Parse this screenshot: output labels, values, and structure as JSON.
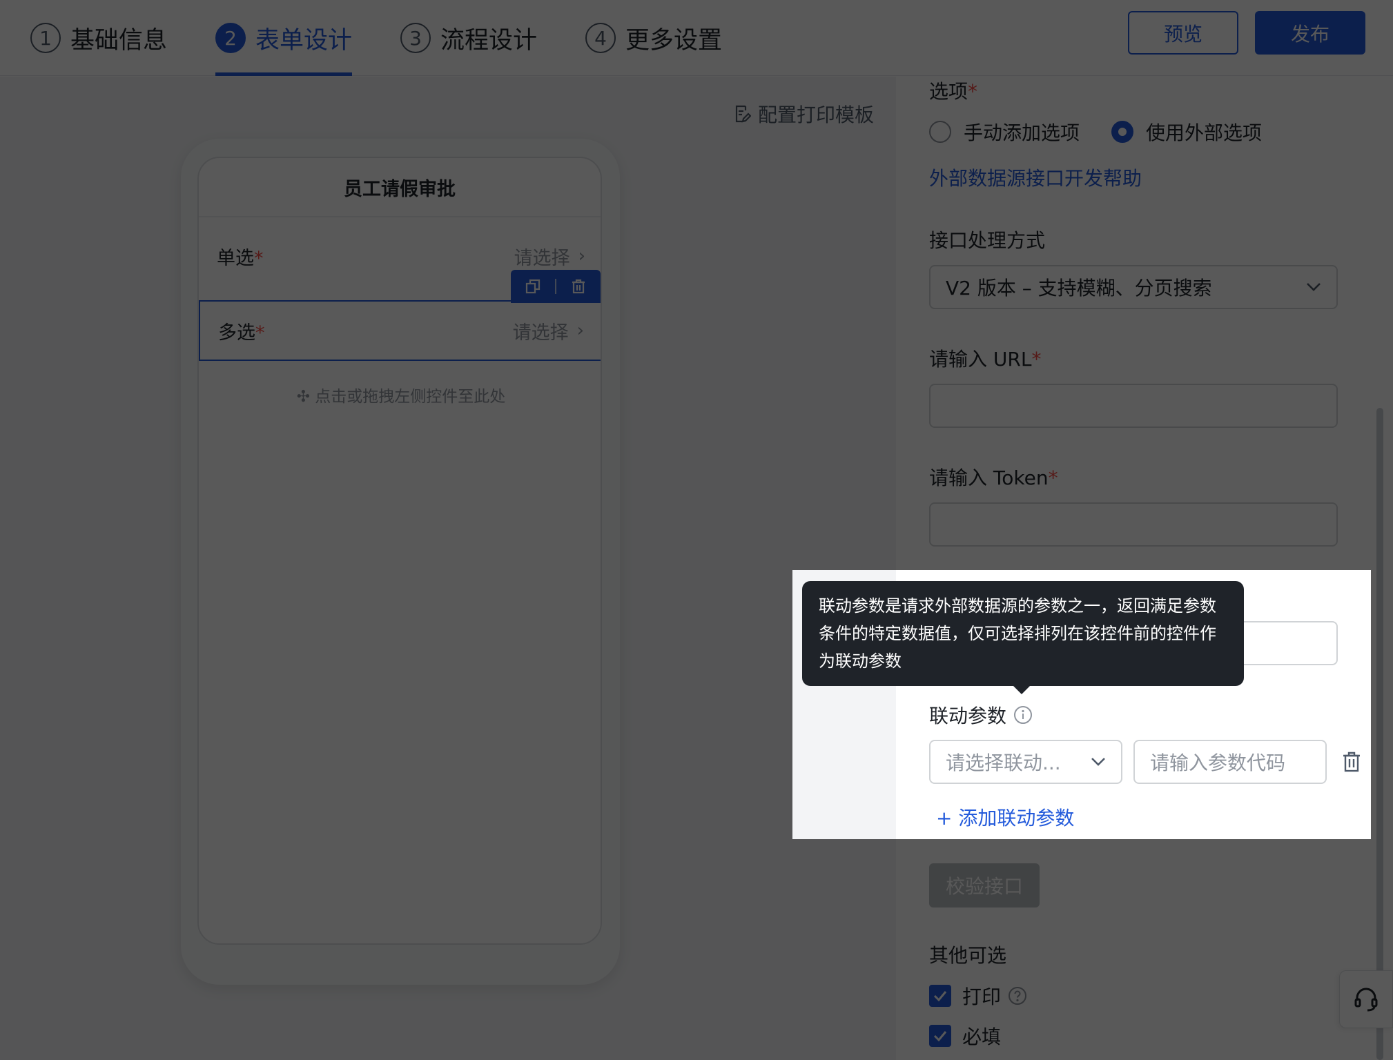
{
  "steps": [
    {
      "num": "1",
      "label": "基础信息"
    },
    {
      "num": "2",
      "label": "表单设计"
    },
    {
      "num": "3",
      "label": "流程设计"
    },
    {
      "num": "4",
      "label": "更多设置"
    }
  ],
  "header": {
    "preview_label": "预览",
    "publish_label": "发布"
  },
  "canvas": {
    "print_template_label": "配置打印模板",
    "form_title": "员工请假审批",
    "fields": [
      {
        "label": "单选",
        "required": "*",
        "placeholder": "请选择",
        "arrow": "›"
      },
      {
        "label": "多选",
        "required": "*",
        "placeholder": "请选择",
        "arrow": "›"
      }
    ],
    "drop_hint": "✣ 点击或拖拽左侧控件至此处"
  },
  "panel": {
    "options_label": "选项",
    "required_mark": "*",
    "option_manual": "手动添加选项",
    "option_external": "使用外部选项",
    "help_link": "外部数据源接口开发帮助",
    "handling_label": "接口处理方式",
    "handling_value": "V2 版本 – 支持模糊、分页搜索",
    "url_label": "请输入 URL",
    "token_label": "请输入 Token",
    "linkage_label": "联动参数",
    "linkage_select_placeholder": "请选择联动...",
    "linkage_input_placeholder": "请输入参数代码",
    "add_linkage": "+ 添加联动参数",
    "verify_label": "校验接口",
    "other_label": "其他可选",
    "print_label": "打印",
    "required_label": "必填"
  },
  "tooltip": {
    "text": "联动参数是请求外部数据源的参数之一，返回满足参数条件的特定数据值，仅可选择排列在该控件前的控件作为联动参数"
  },
  "colors": {
    "primary": "#245bdb",
    "required": "#f54a45",
    "tooltip_bg": "#1f2329"
  }
}
